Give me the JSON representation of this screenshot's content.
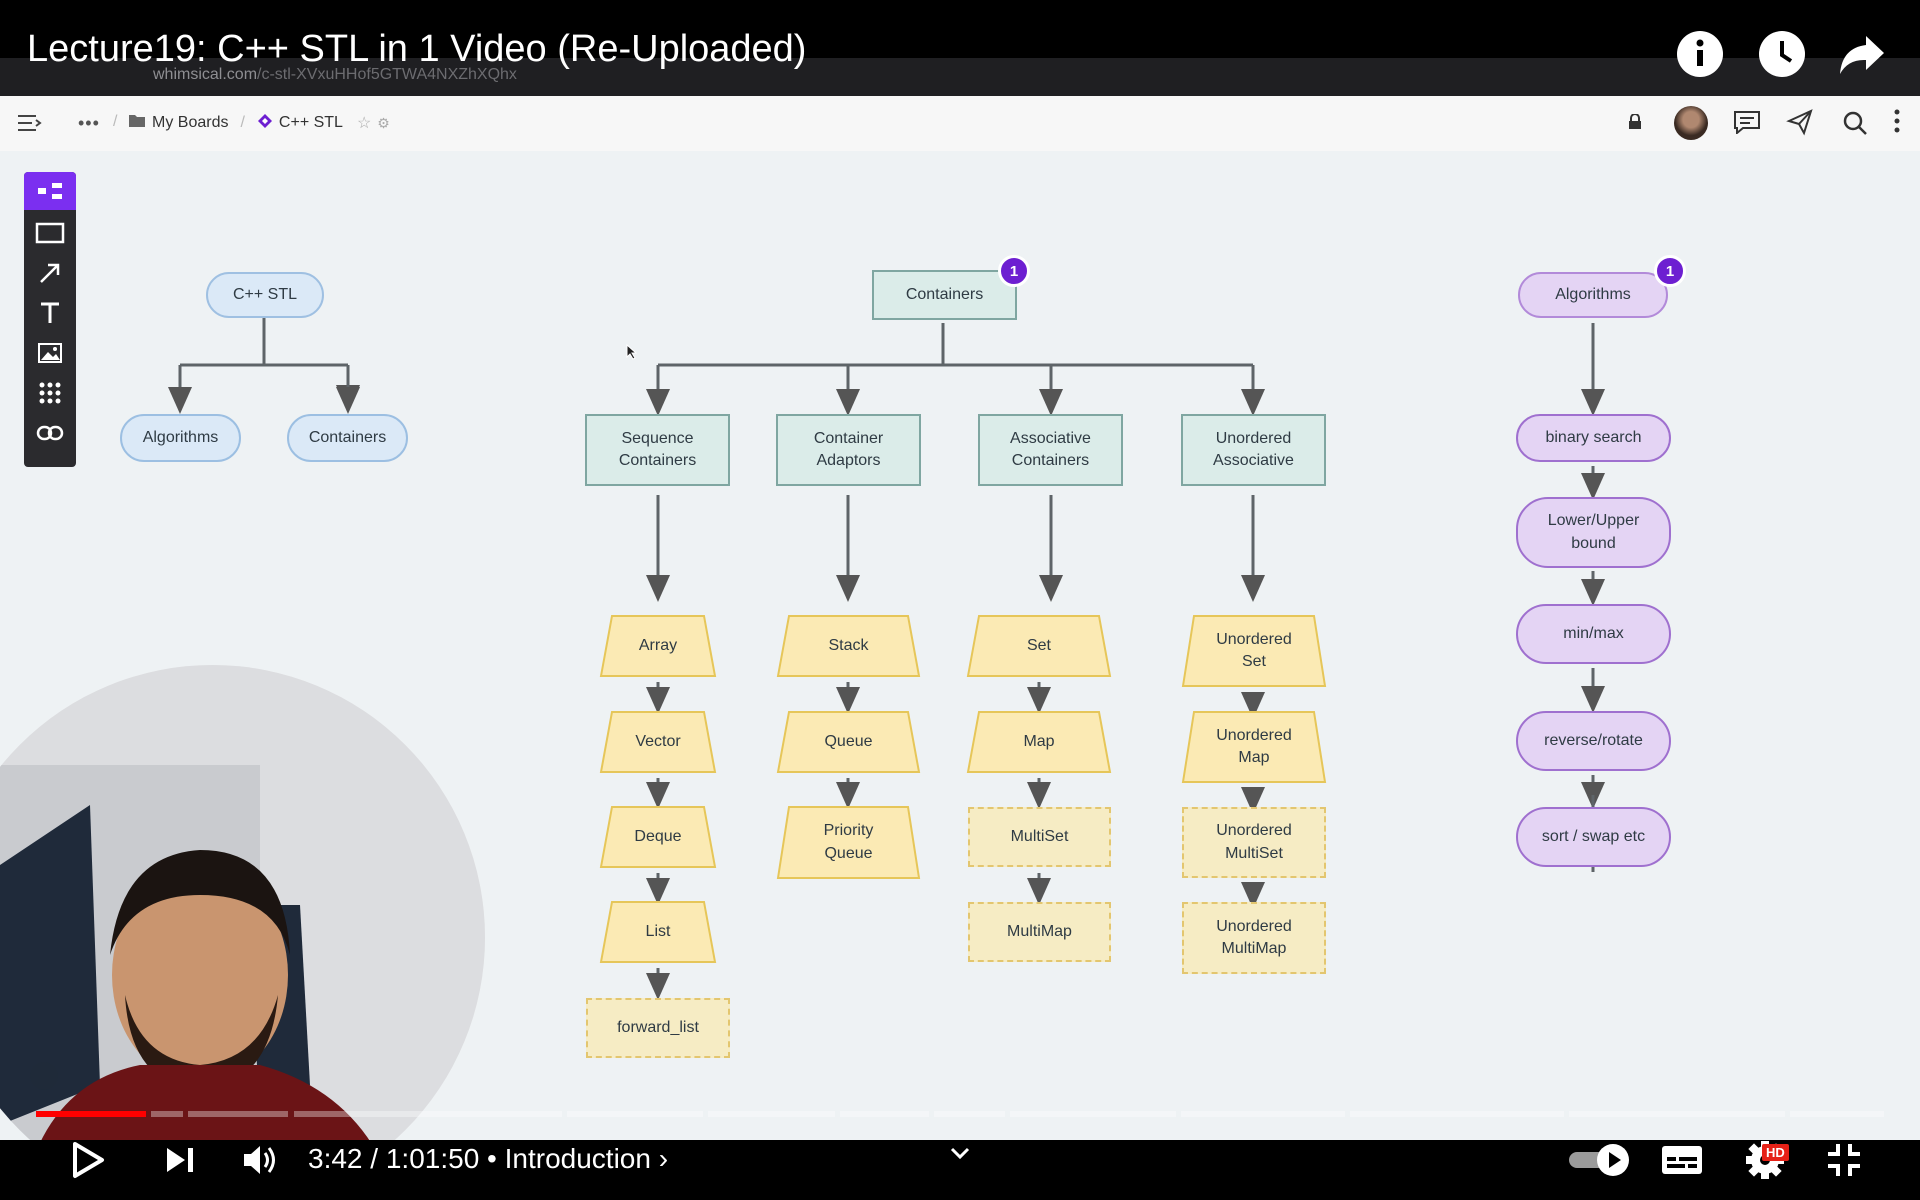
{
  "video": {
    "title": "Lecture19: C++ STL in 1 Video (Re-Uploaded)",
    "time_current": "3:42",
    "time_total": "1:01:50",
    "chapter": "• Introduction ›",
    "progress_fraction": 0.06,
    "hd_badge": "HD"
  },
  "browser": {
    "url_host": "whimsical.com",
    "url_path": "/c-stl-XVxuHHof5GTWA4NXZhXQhx"
  },
  "app": {
    "breadcrumb_boards": "My Boards",
    "breadcrumb_sep": "/",
    "board_name": "C++ STL"
  },
  "diagram": {
    "left": {
      "root": "C++ STL",
      "child_1": "Algorithms",
      "child_2": "Containers"
    },
    "containers": {
      "root": "Containers",
      "badge": "1",
      "categories": [
        {
          "line1": "Sequence",
          "line2": "Containers"
        },
        {
          "line1": "Container",
          "line2": "Adaptors"
        },
        {
          "line1": "Associative",
          "line2": "Containers"
        },
        {
          "line1": "Unordered",
          "line2": "Associative"
        }
      ],
      "sequence": [
        "Array",
        "Vector",
        "Deque",
        "List",
        "forward_list"
      ],
      "adaptors": [
        "Stack",
        "Queue",
        "Priority",
        "Queue"
      ],
      "associative": [
        "Set",
        "Map",
        "MultiSet",
        "MultiMap"
      ],
      "unordered": [
        "Unordered",
        "Set",
        "Unordered",
        "Map",
        "Unordered",
        "MultiSet",
        "Unordered",
        "MultiMap"
      ]
    },
    "algorithms": {
      "root": "Algorithms",
      "badge": "1",
      "items": [
        "binary search",
        "Lower/Upper",
        "bound",
        "min/max",
        "reverse/rotate",
        "sort / swap etc"
      ]
    }
  },
  "colors": {
    "accent_purple": "#6d1fd1",
    "progress_red": "#ff0000",
    "trapezoid_fill": "#fbeab4",
    "trapezoid_stroke": "#e6c659"
  },
  "icons": [
    "info-icon",
    "clock-icon",
    "share-icon",
    "play-icon",
    "next-icon",
    "volume-icon",
    "chevron-down-icon",
    "autoplay-toggle-icon",
    "subtitles-icon",
    "settings-icon",
    "exit-fullscreen-icon"
  ]
}
